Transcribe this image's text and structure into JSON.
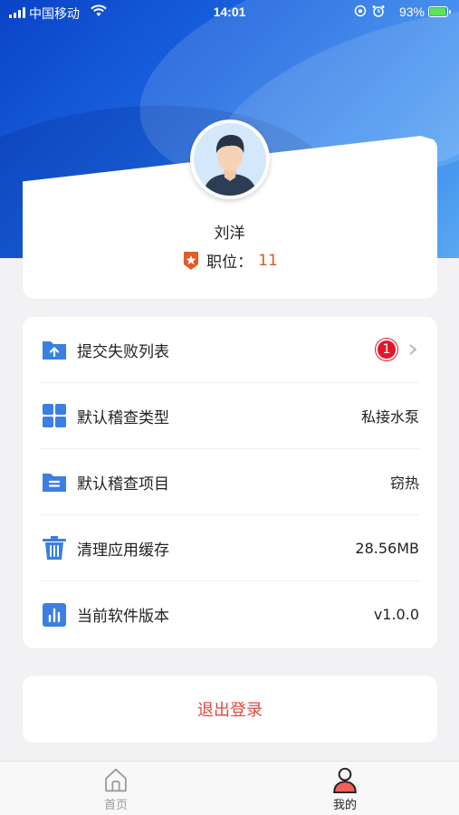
{
  "status_bar": {
    "carrier": "中国移动",
    "time": "14:01",
    "battery_percent": "93%",
    "battery_level": 0.93
  },
  "profile": {
    "name": "刘洋",
    "position_label": "职位：",
    "position_value": "11"
  },
  "settings": [
    {
      "label": "提交失败列表",
      "badge": "1",
      "icon": "upload-folder-icon"
    },
    {
      "label": "默认稽查类型",
      "value": "私接水泵",
      "icon": "grid-icon"
    },
    {
      "label": "默认稽查项目",
      "value": "窃热",
      "icon": "document-folder-icon"
    },
    {
      "label": "清理应用缓存",
      "value": "28.56MB",
      "icon": "trash-icon"
    },
    {
      "label": "当前软件版本",
      "value": "v1.0.0",
      "icon": "bar-chart-icon"
    }
  ],
  "logout_label": "退出登录",
  "tabbar": {
    "home_label": "首页",
    "me_label": "我的"
  },
  "colors": {
    "accent": "#3b7fe0",
    "badge": "#e8152a",
    "logout": "#e0483d",
    "position_value": "#d45a26"
  }
}
